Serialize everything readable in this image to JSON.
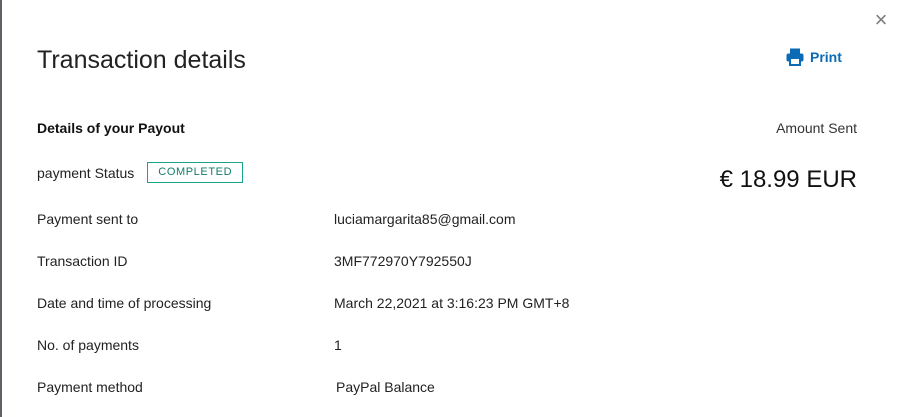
{
  "dialog": {
    "title": "Transaction details",
    "close_glyph": "×",
    "print_label": "Print",
    "print_icon": "printer-icon",
    "accent_color": "#0b6bb5"
  },
  "details": {
    "section_title": "Details of your Payout",
    "amount_label": "Amount Sent",
    "amount_value": "€ 18.99 EUR",
    "status_label": "payment Status",
    "status_badge": "COMPLETED",
    "status_color": "#1aa38b",
    "rows": [
      {
        "label": "Payment sent to",
        "value": "luciamargarita85@gmail.com"
      },
      {
        "label": "Transaction ID",
        "value": "3MF772970Y792550J"
      },
      {
        "label": "Date and time of processing",
        "value": "March 22,2021 at 3:16:23 PM GMT+8"
      },
      {
        "label": "No. of payments",
        "value": "1"
      },
      {
        "label": "Payment method",
        "value": "PayPal Balance"
      }
    ]
  }
}
